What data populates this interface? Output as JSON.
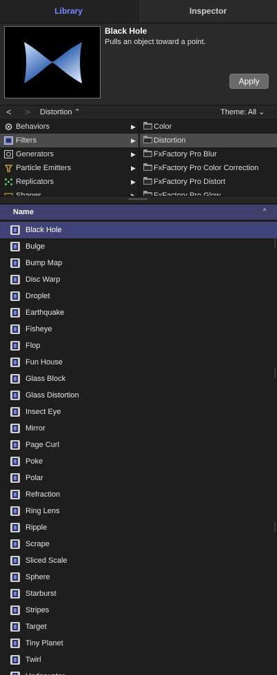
{
  "tabs": {
    "library": "Library",
    "inspector": "Inspector"
  },
  "preview": {
    "title": "Black Hole",
    "description": "Pulls an object toward a point.",
    "apply_label": "Apply"
  },
  "nav": {
    "back": "<",
    "forward": ">",
    "breadcrumb": "Distortion ⌃",
    "theme": "Theme: All ⌄"
  },
  "categories": [
    {
      "label": "Behaviors",
      "icon": "gear-icon"
    },
    {
      "label": "Filters",
      "icon": "filter-icon",
      "selected": true
    },
    {
      "label": "Generators",
      "icon": "generator-icon"
    },
    {
      "label": "Particle Emitters",
      "icon": "emitter-icon"
    },
    {
      "label": "Replicators",
      "icon": "replicator-icon"
    },
    {
      "label": "Shapes",
      "icon": "shapes-icon"
    }
  ],
  "subcategories": [
    {
      "label": "Color"
    },
    {
      "label": "Distortion",
      "selected": true
    },
    {
      "label": "FxFactory Pro Blur"
    },
    {
      "label": "FxFactory Pro Color Correction"
    },
    {
      "label": "FxFactory Pro Distort"
    },
    {
      "label": "FxFactory Pro Glow"
    }
  ],
  "list_header": {
    "name": "Name",
    "sort": "^"
  },
  "items": [
    "Black Hole",
    "Bulge",
    "Bump Map",
    "Disc Warp",
    "Droplet",
    "Earthquake",
    "Fisheye",
    "Flop",
    "Fun House",
    "Glass Block",
    "Glass Distortion",
    "Insect Eye",
    "Mirror",
    "Page Curl",
    "Poke",
    "Polar",
    "Refraction",
    "Ring Lens",
    "Ripple",
    "Scrape",
    "Sliced Scale",
    "Sphere",
    "Starburst",
    "Stripes",
    "Target",
    "Tiny Planet",
    "Twirl",
    "Underwater"
  ],
  "selected_item": "Black Hole",
  "colors": {
    "accent": "#7a86ff",
    "selection": "#3f4375",
    "header": "#3d3f6c"
  }
}
